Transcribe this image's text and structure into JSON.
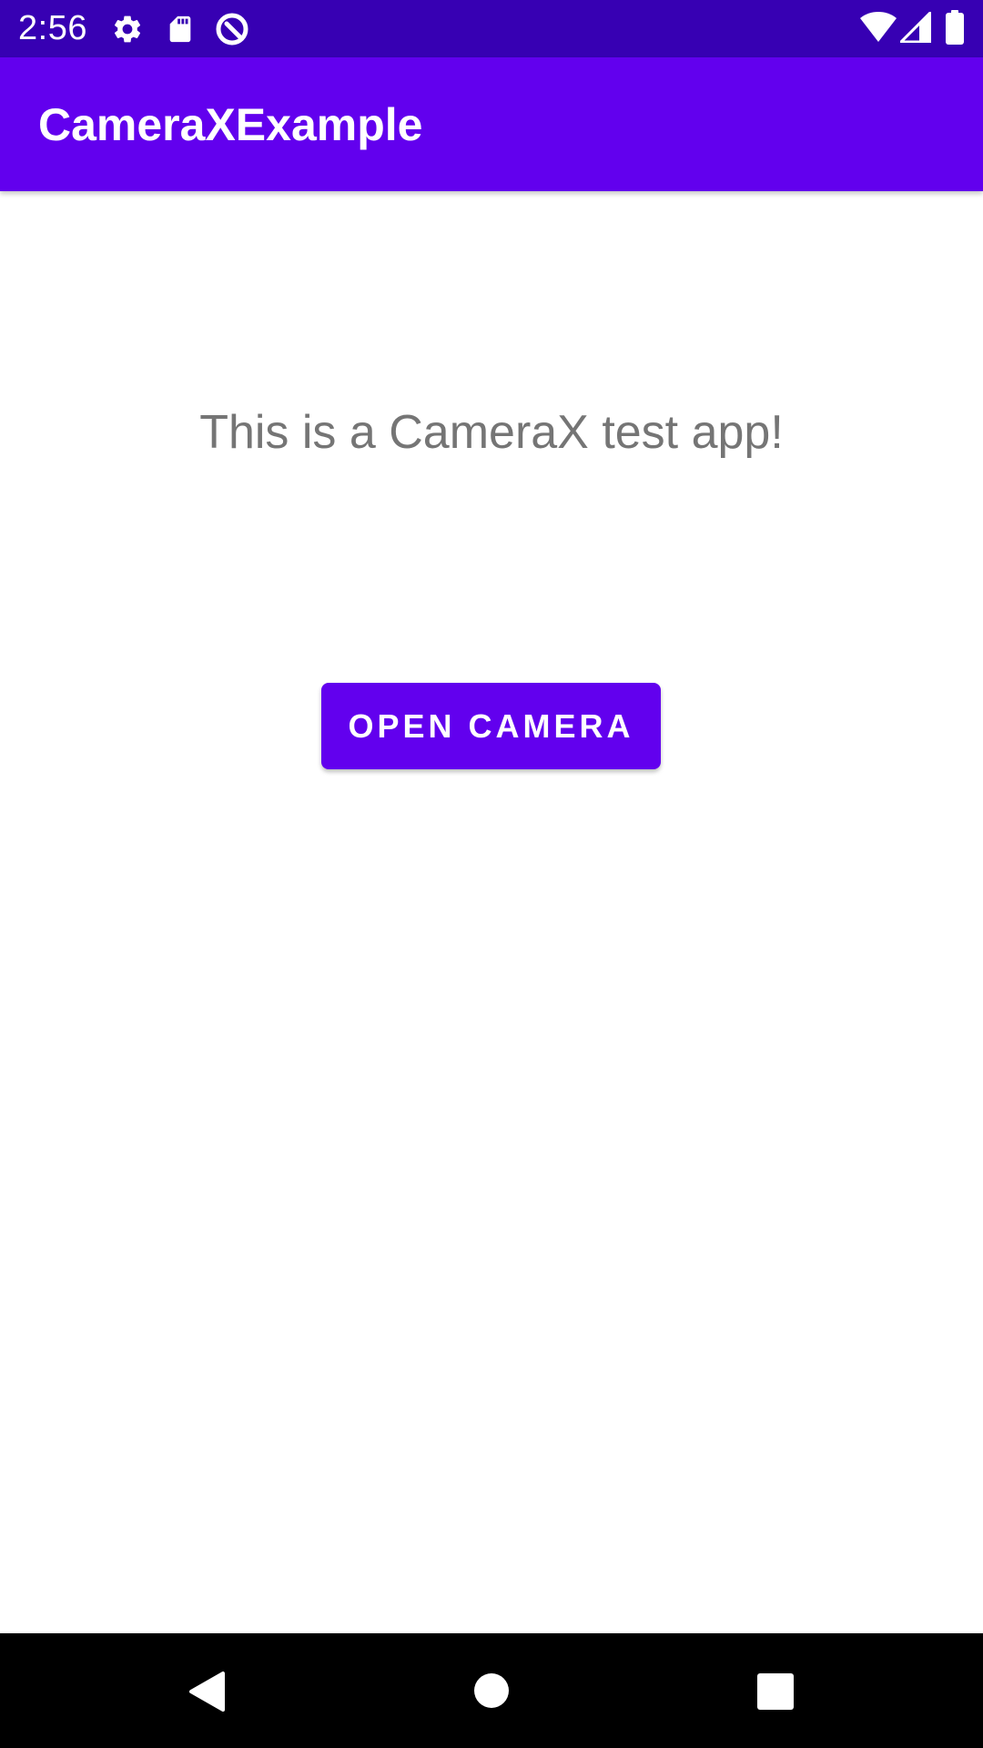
{
  "status_bar": {
    "time": "2:56",
    "left_icons": [
      "settings-gear-icon",
      "sd-card-icon",
      "data-saver-icon"
    ],
    "right_icons": [
      "wifi-icon",
      "cellular-signal-icon",
      "battery-icon"
    ]
  },
  "app_bar": {
    "title": "CameraXExample"
  },
  "main": {
    "message": "This is a CameraX test app!",
    "open_camera_label": "OPEN CAMERA"
  },
  "navigation_bar": {
    "buttons": [
      "back-icon",
      "home-icon",
      "recents-icon"
    ]
  },
  "colors": {
    "status_bar": "#3700b3",
    "primary": "#6200ee",
    "message_text": "#757575",
    "background": "#ffffff",
    "navigation_bar": "#000000"
  }
}
